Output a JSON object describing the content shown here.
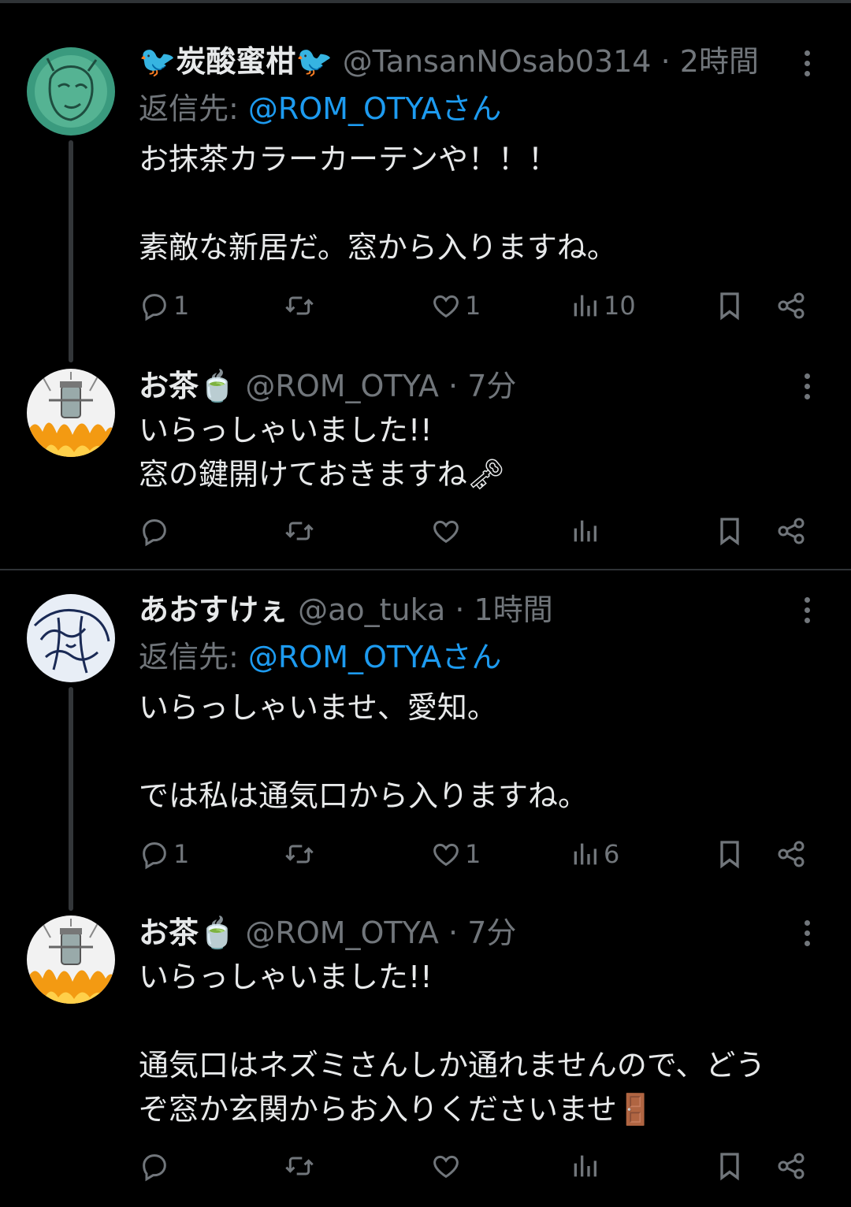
{
  "tweets": [
    {
      "name": "炭酸蜜柑",
      "handle": "@TansanNOsab0314",
      "dot": "·",
      "time": "2時間",
      "reply_label": "返信先: ",
      "reply_mention": "@ROM_OTYAさん",
      "body": "お抹茶カラーカーテンや！！！\n\n素敵な新居だ。窓から入りますね。",
      "counts": {
        "reply": "1",
        "retweet": "",
        "like": "1",
        "views": "10"
      }
    },
    {
      "name": "お茶🍵",
      "handle": "@ROM_OTYA",
      "dot": "·",
      "time": "7分",
      "body": "いらっしゃいました!!\n窓の鍵開けておきますね🗝",
      "counts": {
        "reply": "",
        "retweet": "",
        "like": "",
        "views": ""
      }
    },
    {
      "name": "あおすけぇ",
      "handle": "@ao_tuka",
      "dot": "·",
      "time": "1時間",
      "reply_label": "返信先: ",
      "reply_mention": "@ROM_OTYAさん",
      "body": "いらっしゃいませ、愛知。\n\nでは私は通気口から入りますね。",
      "counts": {
        "reply": "1",
        "retweet": "",
        "like": "1",
        "views": "6"
      }
    },
    {
      "name": "お茶🍵",
      "handle": "@ROM_OTYA",
      "dot": "·",
      "time": "7分",
      "body": "いらっしゃいました!!\n\n通気口はネズミさんしか通れませんので、どう\nぞ窓か玄関からお入りくださいませ🚪",
      "counts": {
        "reply": "",
        "retweet": "",
        "like": "",
        "views": ""
      }
    }
  ],
  "colors": {
    "background": "#000000",
    "text": "#e7e9ea",
    "muted": "#71767b",
    "link": "#1d9bf0",
    "divider": "#2f3336"
  },
  "icons": [
    "reply-icon",
    "retweet-icon",
    "like-icon",
    "views-icon",
    "bookmark-icon",
    "share-icon",
    "more-icon"
  ]
}
